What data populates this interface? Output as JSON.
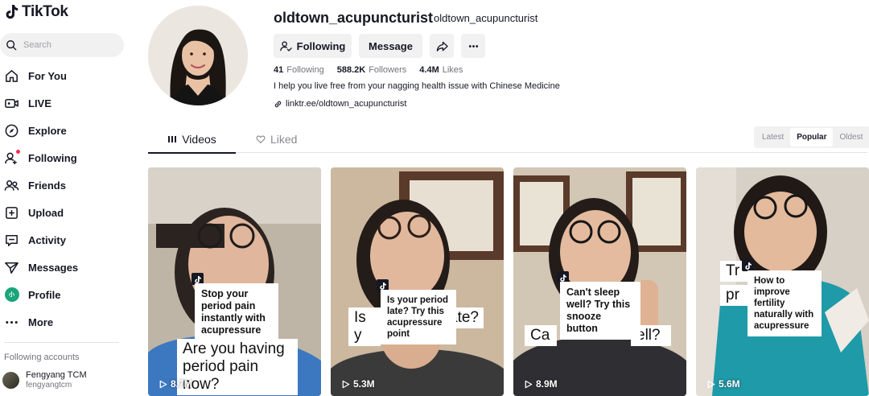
{
  "app": {
    "name": "TikTok"
  },
  "search": {
    "placeholder": "Search"
  },
  "nav": [
    {
      "label": "For You",
      "icon": "home-icon"
    },
    {
      "label": "LIVE",
      "icon": "live-icon"
    },
    {
      "label": "Explore",
      "icon": "compass-icon"
    },
    {
      "label": "Following",
      "icon": "following-icon"
    },
    {
      "label": "Friends",
      "icon": "friends-icon"
    },
    {
      "label": "Upload",
      "icon": "upload-icon"
    },
    {
      "label": "Activity",
      "icon": "activity-icon"
    },
    {
      "label": "Messages",
      "icon": "messages-icon"
    },
    {
      "label": "Profile",
      "icon": "profile-avatar"
    },
    {
      "label": "More",
      "icon": "more-icon"
    }
  ],
  "following_accounts": {
    "title": "Following accounts",
    "items": [
      {
        "name": "Fengyang TCM",
        "username": "fengyangtcm"
      }
    ]
  },
  "profile": {
    "username": "oldtown_acupuncturist",
    "nickname": "oldtown_acupuncturist",
    "buttons": {
      "following": "Following",
      "message": "Message"
    },
    "stats": {
      "following_count": "41",
      "following_label": "Following",
      "followers_count": "588.2K",
      "followers_label": "Followers",
      "likes_count": "4.4M",
      "likes_label": "Likes"
    },
    "bio": "I help you live free from your nagging health issue with Chinese Medicine",
    "link": "linktr.ee/oldtown_acupuncturist"
  },
  "tabs": {
    "videos": "Videos",
    "liked": "Liked"
  },
  "sort": {
    "latest": "Latest",
    "popular": "Popular",
    "oldest": "Oldest",
    "active": "Popular"
  },
  "videos": [
    {
      "caption": "Stop your period pain instantly with acupressure",
      "overlay": "Are you having period pain now?",
      "views": "8.7M"
    },
    {
      "caption": "Is your period late? Try this acupressure point",
      "overlay": "Is y",
      "overlay2": "ate?",
      "views": "5.3M"
    },
    {
      "caption": "Can't sleep well? Try this snooze button",
      "overlay": "Ca",
      "overlay2": "ell?",
      "views": "8.9M"
    },
    {
      "caption": "How to improve fertility naturally with acupressure",
      "overlay": "Tr",
      "overlay2": "pr",
      "views": "5.6M"
    }
  ],
  "colors": {
    "accent": "#fe2c55",
    "text": "#161823",
    "muted": "#73747b",
    "chip": "#f1f1f2"
  }
}
